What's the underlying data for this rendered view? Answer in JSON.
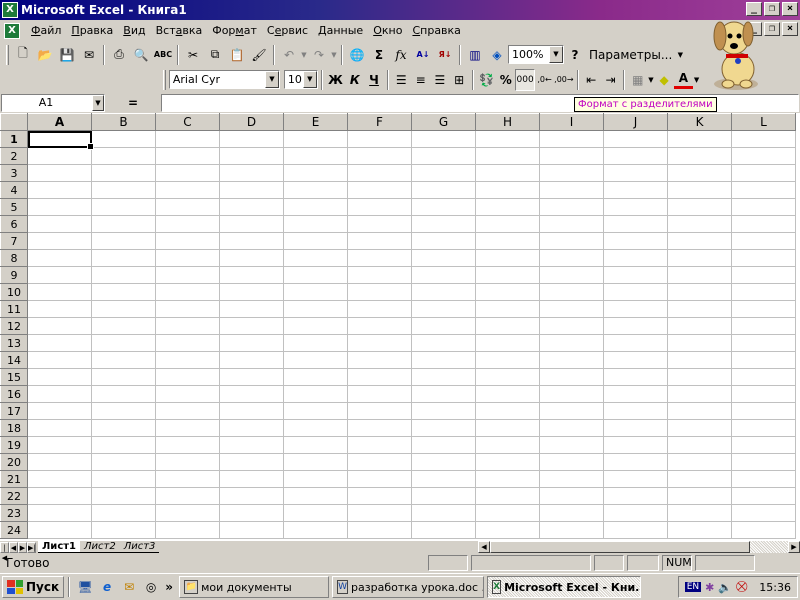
{
  "window": {
    "title": "Microsoft Excel - Книга1",
    "app_icon": "X"
  },
  "menu": [
    {
      "u": "Ф",
      "rest": "айл"
    },
    {
      "u": "П",
      "rest": "равка"
    },
    {
      "u": "В",
      "rest": "ид"
    },
    {
      "u": "",
      "rest": "Вст",
      "u2": "а",
      "rest2": "вка"
    },
    {
      "u": "",
      "rest": "Фор",
      "u2": "м",
      "rest2": "ат"
    },
    {
      "u": "",
      "rest": "С",
      "u2": "е",
      "rest2": "рвис"
    },
    {
      "u": "Д",
      "rest": "анные"
    },
    {
      "u": "О",
      "rest": "кно"
    },
    {
      "u": "",
      "rest": "",
      "u2": "С",
      "rest2": "правка"
    }
  ],
  "standard_toolbar": {
    "zoom": "100%",
    "params_label": "Параметры..."
  },
  "format_toolbar": {
    "font": "Arial Cyr",
    "size": "10",
    "bold": "Ж",
    "italic": "К",
    "underline": "Ч",
    "percent": "%",
    "thousands": "000"
  },
  "formula_bar": {
    "cell_ref": "A1",
    "equals": "=",
    "value": ""
  },
  "tooltip": "Формат с разделителями",
  "grid": {
    "columns": [
      "A",
      "B",
      "C",
      "D",
      "E",
      "F",
      "G",
      "H",
      "I",
      "J",
      "K",
      "L"
    ],
    "rows": [
      "1",
      "2",
      "3",
      "4",
      "5",
      "6",
      "7",
      "8",
      "9",
      "10",
      "11",
      "12",
      "13",
      "14",
      "15",
      "16",
      "17",
      "18",
      "19",
      "20",
      "21",
      "22",
      "23",
      "24"
    ],
    "selected": "A1"
  },
  "sheets": [
    "Лист1",
    "Лист2",
    "Лист3"
  ],
  "status": {
    "text": "Готово",
    "num": "NUM"
  },
  "taskbar": {
    "start": "Пуск",
    "tasks": [
      {
        "label": "мои документы",
        "icon": "folder-icon"
      },
      {
        "label": "разработка урока.doc ...",
        "icon": "word-icon"
      },
      {
        "label": "Microsoft Excel - Кни...",
        "icon": "excel-icon",
        "active": true
      }
    ],
    "lang": "EN",
    "clock": "15:36"
  }
}
